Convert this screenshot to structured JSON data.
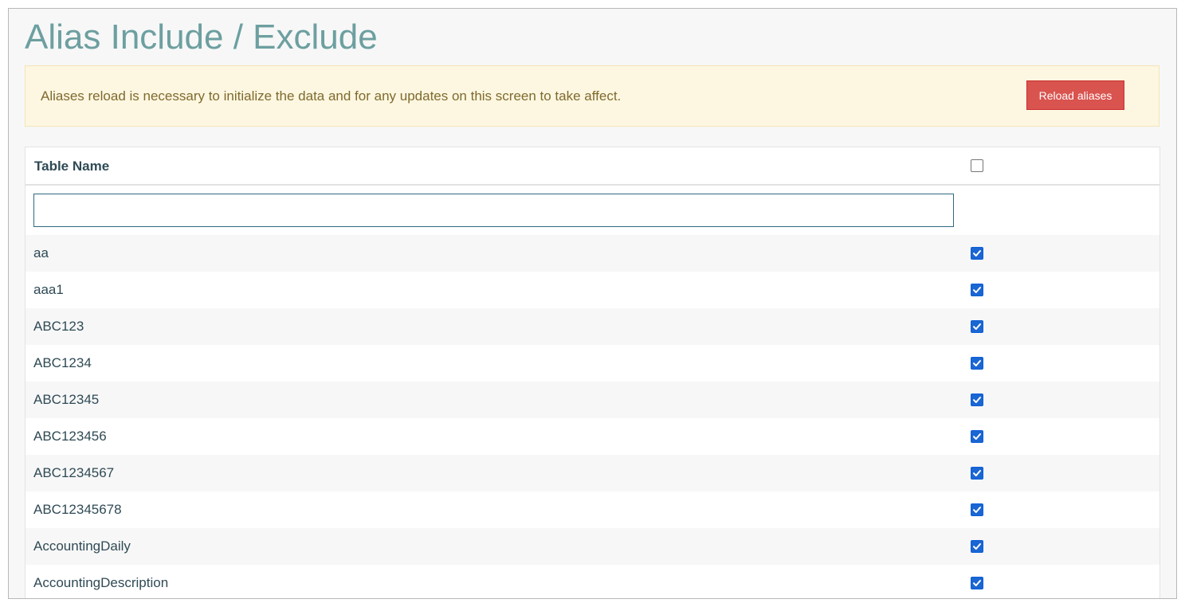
{
  "page": {
    "title": "Alias Include / Exclude"
  },
  "alert": {
    "message": "Aliases reload is necessary to initialize the data and for any updates on this screen to take affect.",
    "button_label": "Reload aliases"
  },
  "table": {
    "header_name": "Table Name",
    "select_all_checked": false,
    "filter_value": "",
    "rows": [
      {
        "name": "aa",
        "checked": true
      },
      {
        "name": "aaa1",
        "checked": true
      },
      {
        "name": "ABC123",
        "checked": true
      },
      {
        "name": "ABC1234",
        "checked": true
      },
      {
        "name": "ABC12345",
        "checked": true
      },
      {
        "name": "ABC123456",
        "checked": true
      },
      {
        "name": "ABC1234567",
        "checked": true
      },
      {
        "name": "ABC12345678",
        "checked": true
      },
      {
        "name": "AccountingDaily",
        "checked": true
      },
      {
        "name": "AccountingDescription",
        "checked": true
      }
    ]
  },
  "colors": {
    "title": "#6d9fa0",
    "alert_bg": "#fdf7e1",
    "danger_button": "#d9534f",
    "checkbox_checked": "#1a66d2"
  }
}
